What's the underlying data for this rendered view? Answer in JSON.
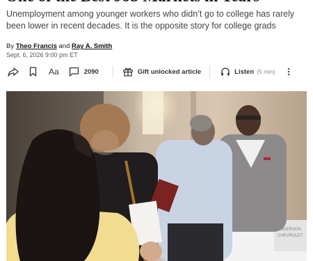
{
  "article": {
    "headline": "One of the Best Job Markets in Years",
    "dek": "Unemployment among younger workers who didn’t go to college has rarely been lower in recent decades. It is the opposite story for college grads",
    "byline_prefix": "By",
    "author1": "Theo Francis",
    "byline_and": "and",
    "author2": "Ray A. Smith",
    "date": "Sept. 6, 2026 9:00 pm ET"
  },
  "toolbar": {
    "share_icon": "share-icon",
    "bookmark_icon": "bookmark-icon",
    "text_size_label": "Aa",
    "comments_icon": "comment-icon",
    "comment_count": "2090",
    "gift_label": "Gift unlocked article",
    "listen_label": "Listen",
    "listen_duration": "(5 min)"
  },
  "photo": {
    "sign_text_1": "ANDERSON",
    "sign_text_2": "CHEVROLET"
  }
}
